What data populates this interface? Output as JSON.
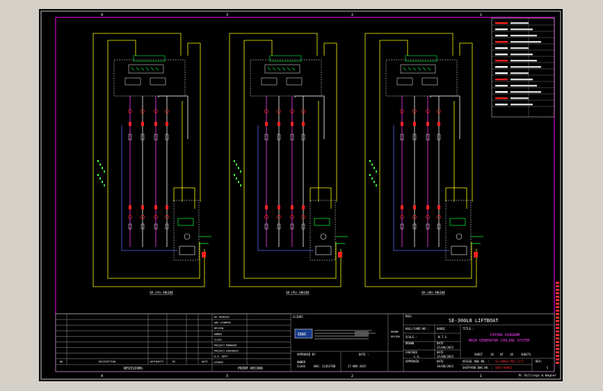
{
  "colors": {
    "window_bg": "#d4d0c8",
    "canvas_bg": "#000000",
    "border": "#c8c8c8",
    "frame": "#ff00ff",
    "pipe_yellow": "#ffff00",
    "pipe_blue": "#4a6cff",
    "pipe_magenta": "#ff40ff",
    "pipe_white": "#ffffff",
    "valve_red": "#ff2020",
    "equip_green": "#00ff40",
    "text_white": "#ffffff",
    "text_red": "#ff3030",
    "text_green": "#40ff40",
    "text_cyan": "#40ffff"
  },
  "border_numbers": {
    "top": [
      "4",
      "3",
      "2",
      "1"
    ],
    "bottom": [
      "4",
      "3",
      "2",
      "1"
    ]
  },
  "systems": [
    {
      "label": "SB-(FA)-ENGINE"
    },
    {
      "label": "SB-(PS)-ENGINE"
    },
    {
      "label": "SB-(SB)-ENGINE"
    }
  ],
  "title_block": {
    "revisions_header": {
      "no": "NO.",
      "description": "DESCRIPTION",
      "authority": "AUTHORITY",
      "by": "BY",
      "date": "DATE"
    },
    "revisions_label": "REVISIONS",
    "print_record_label": "PRINT RECORD",
    "print_items": [
      "OG PRINTED",
      "ABS STAMPED",
      "REVIEW",
      "OWNER",
      "CLASS",
      "PROJECT MANAGER",
      "PROJECT ENGINEER",
      "Q.A. DEPT.",
      "OTHERS"
    ],
    "client_label": "CLIENT:",
    "approved_by_label": "APPROVED BY",
    "class_label": "CLASS",
    "abs_no": "ABS: 11453788",
    "date_label": "DATE :",
    "date_value": "27-NOV-2015",
    "owner_label": "OWNER",
    "vessel_label": "HULL",
    "vessel_name": "SE-300L8 LIFTBOAT",
    "title_label": "TITLE :",
    "title_line1": "PIPING DIAGRAM",
    "title_line2": "MAIN GENERATOR COOLING SYSTEM",
    "drawn_label": "DRAWN",
    "design_label": "DESIGN",
    "hull_yard_label": "HULL/YARD NO :",
    "hull_yard_value": "H4802",
    "scale_label": "SCALE :",
    "scale_value": "N.T.S",
    "date2_label": "DATE",
    "date2_value": "15/08/2015",
    "checked_label": "CHECKED",
    "checked_value": "L.G.",
    "date3_label": "DATE",
    "date3_value": "15/08/2015",
    "approved_label": "APPROVED",
    "date4_label": "DATE",
    "date4_value": "18/08/2015",
    "sheet_label": "SHEET",
    "sheet_no": "18",
    "of_label": "OF",
    "sheet_total": "18",
    "sheets_label": "SHEETS",
    "vessel_dwg_label": "VESSEL DWG NO. :",
    "vessel_dwg_value": "SE-H4802-PDG-7177",
    "shipyard_dwg_label": "SHIPYARD DWG NO. :",
    "shipyard_dwg_value": "SHGS-H4802",
    "rev_label": "REV:",
    "rev_value": "C",
    "footer_note": "M: Billings & Wagner"
  }
}
